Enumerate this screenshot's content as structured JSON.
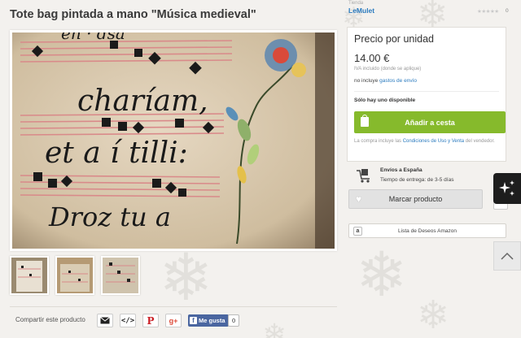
{
  "product": {
    "title": "Tote bag pintada a mano \"Música medieval\""
  },
  "shop": {
    "label": "Tienda",
    "name": "LeMulet",
    "rating_count": "0"
  },
  "purchase": {
    "price_label": "Precio por unidad",
    "price": "14.00 €",
    "vat_note": "IVA incluido (donde se aplique)",
    "shipping_prefix": "no incluye",
    "shipping_link": "gastos de envío",
    "stock": "Sólo hay uno disponible",
    "add_to_cart": "Añadir a cesta",
    "terms_prefix": "La compra incluye las",
    "terms_link": "Condiciones de Uso y Venta",
    "terms_suffix": "del vendedor."
  },
  "shipping_info": {
    "title": "Envíos a España",
    "delivery_time": "Tiempo de entrega: de 3-5 días"
  },
  "actions": {
    "mark_product": "Marcar producto",
    "amazon_wishlist": "Lista de Deseos Amazon",
    "amazon_icon": "a"
  },
  "share": {
    "label": "Compartir este producto",
    "fb_like": "Me gusta",
    "fb_count": "0"
  },
  "icons": {
    "email": "email-icon",
    "embed": "embed-icon",
    "pinterest": "pinterest-icon",
    "google_plus": "google-plus-icon"
  },
  "colors": {
    "accent_green": "#86ba2c",
    "link_blue": "#2b7bbf",
    "facebook": "#4a66a0"
  }
}
